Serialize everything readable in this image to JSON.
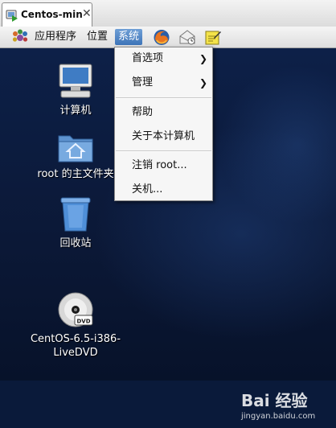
{
  "vm_tab": {
    "title": "Centos-min",
    "close_glyph": "✕"
  },
  "panel": {
    "applications": "应用程序",
    "places": "位置",
    "system": "系统",
    "launchers": [
      "firefox-icon",
      "mail-client-icon",
      "notes-editor-icon"
    ]
  },
  "system_menu": {
    "preferences": "首选项",
    "administration": "管理",
    "help": "帮助",
    "about": "关于本计算机",
    "logout": "注销 root...",
    "shutdown": "关机...",
    "submenu_arrow": "❯"
  },
  "desktop": {
    "computer": "计算机",
    "home": "root 的主文件夹",
    "trash": "回收站",
    "dvd_line1": "CentOS-6.5-i386-",
    "dvd_line2": "LiveDVD",
    "dvd_badge": "DVD"
  },
  "watermark": {
    "logo": "Bai 经验",
    "url": "jingyan.baidu.com"
  },
  "colors": {
    "panel_highlight": "#3d74b8",
    "desktop_bg": "#0b1836",
    "menu_bg": "#f6f6f6"
  }
}
